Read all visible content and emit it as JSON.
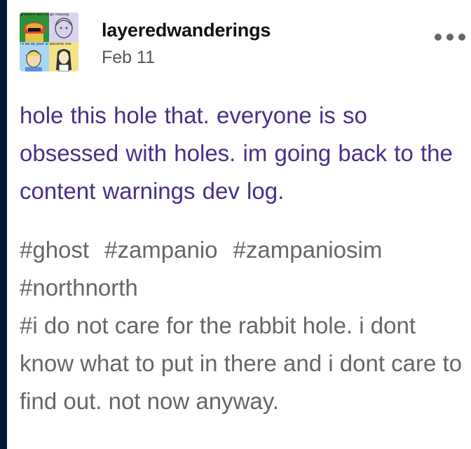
{
  "post": {
    "username": "layeredwanderings",
    "date": "Feb 11",
    "avatar": {
      "top_left_caption": "gradient ascii hell",
      "top_right_caption": "go missing",
      "bottom_left_caption": "i'll be by your side",
      "bottom_right_caption": "become this"
    },
    "more_icon": "ellipsis-icon",
    "body": "hole this hole that. everyone is so obsessed with holes. im going back to the content warnings dev log.",
    "tags": [
      "#ghost",
      "#zampanio",
      "#zampaniosim",
      "#northnorth",
      "#i do not care for the rabbit hole. i dont know what to put in there and i dont care to find out. not now anyway."
    ]
  },
  "colors": {
    "body_text": "#4a2e8a",
    "tag_text": "#666666",
    "page_background": "#001935"
  }
}
